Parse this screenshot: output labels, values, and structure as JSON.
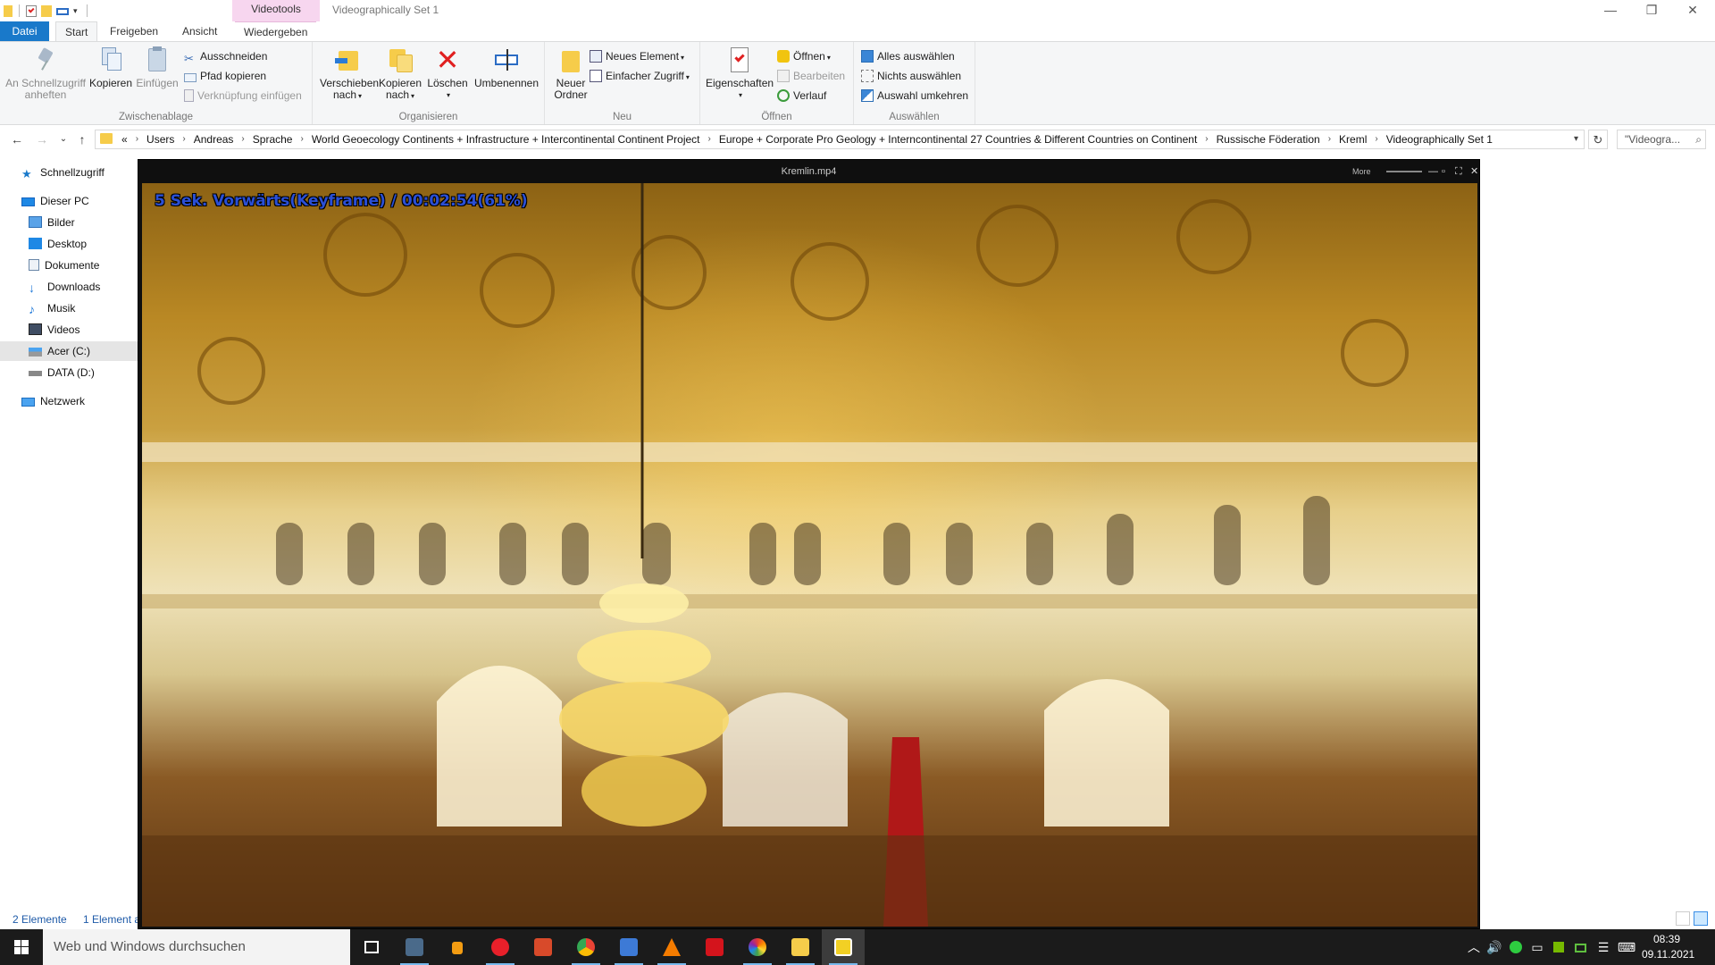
{
  "window": {
    "contextual_tab_group": "Videotools",
    "title": "Videographically Set 1"
  },
  "tabs": [
    "Datei",
    "Start",
    "Freigeben",
    "Ansicht",
    "Wiedergeben"
  ],
  "ribbon": {
    "zwischenablage": {
      "label": "Zwischenablage",
      "pin_label_1": "An Schnellzugriff",
      "pin_label_2": "anheften",
      "copy": "Kopieren",
      "paste": "Einfügen",
      "cut": "Ausschneiden",
      "copy_path": "Pfad kopieren",
      "paste_shortcut": "Verknüpfung einfügen"
    },
    "organisieren": {
      "label": "Organisieren",
      "move_1": "Verschieben",
      "move_2": "nach",
      "copyto_1": "Kopieren",
      "copyto_2": "nach",
      "delete": "Löschen",
      "rename": "Umbenennen"
    },
    "neu": {
      "label": "Neu",
      "new_folder_1": "Neuer",
      "new_folder_2": "Ordner",
      "new_item": "Neues Element",
      "easy_access": "Einfacher Zugriff"
    },
    "oeffnen": {
      "label": "Öffnen",
      "properties": "Eigenschaften",
      "open": "Öffnen",
      "edit": "Bearbeiten",
      "history": "Verlauf"
    },
    "auswaehlen": {
      "label": "Auswählen",
      "select_all": "Alles auswählen",
      "select_none": "Nichts auswählen",
      "invert": "Auswahl umkehren"
    }
  },
  "address": {
    "overflow": "«",
    "crumbs": [
      "Users",
      "Andreas",
      "Sprache",
      "World Geoecology Continents + Infrastructure + Intercontinental Continent Project",
      "Europe  + Corporate Pro Geology + Interncontinental 27 Countries & Different Countries on Continent",
      "Russische Föderation",
      "Kreml",
      "Videographically Set 1"
    ],
    "search_placeholder": "\"Videogra..."
  },
  "navpane": {
    "quick_access": "Schnellzugriff",
    "this_pc": "Dieser PC",
    "pictures": "Bilder",
    "desktop": "Desktop",
    "documents": "Dokumente",
    "downloads": "Downloads",
    "music": "Musik",
    "videos": "Videos",
    "drive_c": "Acer (C:)",
    "drive_d": "DATA (D:)",
    "network": "Netzwerk"
  },
  "status": {
    "count": "2 Elemente",
    "selected": "1 Element a"
  },
  "player": {
    "filename": "Kremlin.mp4",
    "more": "More",
    "osd": "5  Sek. Vorwärts(Keyframe) / 00:02:54(61%)",
    "progress_percent": 61
  },
  "taskbar": {
    "search_placeholder": "Web und Windows durchsuchen",
    "time": "08:39",
    "date": "09.11.2021"
  },
  "colors": {
    "accent": "#1979ca",
    "videotools_tab": "#f7d6ef",
    "osd_text": "#2a4fd6",
    "taskbar": "#1b1b1b"
  }
}
